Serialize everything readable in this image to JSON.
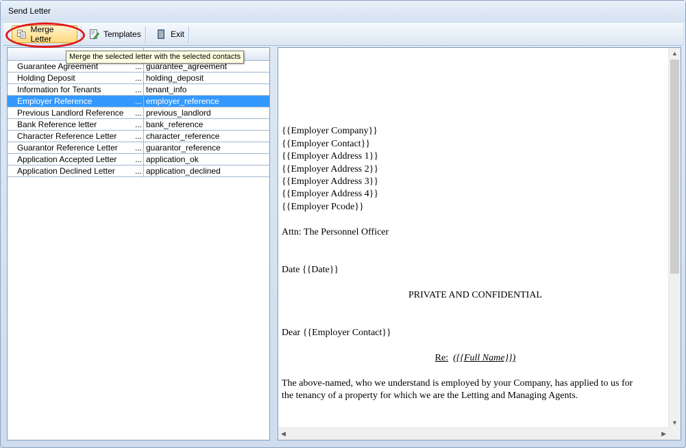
{
  "window": {
    "title": "Send Letter"
  },
  "toolbar": {
    "merge_label": "Merge Letter",
    "templates_label": "Templates",
    "exit_label": "Exit",
    "merge_tooltip": "Merge the selected letter with the selected contacts"
  },
  "letters": {
    "selected_index": 3,
    "rows": [
      {
        "name": "Guarantee Agreement",
        "dots": "...",
        "file": "guarantee_agreement"
      },
      {
        "name": "Holding Deposit",
        "dots": "...",
        "file": "holding_deposit"
      },
      {
        "name": "Information for Tenants",
        "dots": "...",
        "file": "tenant_info"
      },
      {
        "name": "Employer Reference",
        "dots": "...",
        "file": "employer_reference"
      },
      {
        "name": "Previous Landlord Reference",
        "dots": "...",
        "file": "previous_landlord"
      },
      {
        "name": "Bank Reference letter",
        "dots": "...",
        "file": "bank_reference"
      },
      {
        "name": "Character Reference Letter",
        "dots": "...",
        "file": "character_reference"
      },
      {
        "name": "Guarantor Reference Letter",
        "dots": "...",
        "file": "guarantor_reference"
      },
      {
        "name": "Application Accepted Letter",
        "dots": "...",
        "file": "application_ok"
      },
      {
        "name": "Application Declined Letter",
        "dots": "...",
        "file": "application_declined"
      }
    ]
  },
  "preview": {
    "address_lines": [
      "{{Employer Company}}",
      "{{Employer Contact}}",
      "{{Employer Address 1}}",
      "{{Employer Address 2}}",
      "{{Employer Address 3}}",
      "{{Employer Address 4}}",
      "{{Employer Pcode}}"
    ],
    "attn": "Attn: The Personnel Officer",
    "date": "Date {{Date}}",
    "heading": "PRIVATE AND CONFIDENTIAL",
    "salutation": "Dear {{Employer Contact}}",
    "re_label": "Re:",
    "re_value": "({{Full Name}})",
    "body_line1": "The above-named, who we understand is employed by your Company, has applied to us for",
    "body_line2": "the tenancy of a property for which we are the Letting and Managing Agents."
  },
  "colors": {
    "selection": "#3399ff",
    "highlight_ring": "#e01818",
    "tooltip_bg": "#ffffe1"
  },
  "icons": {
    "merge": "merge-document-icon",
    "templates": "edit-template-icon",
    "exit": "exit-door-icon"
  }
}
